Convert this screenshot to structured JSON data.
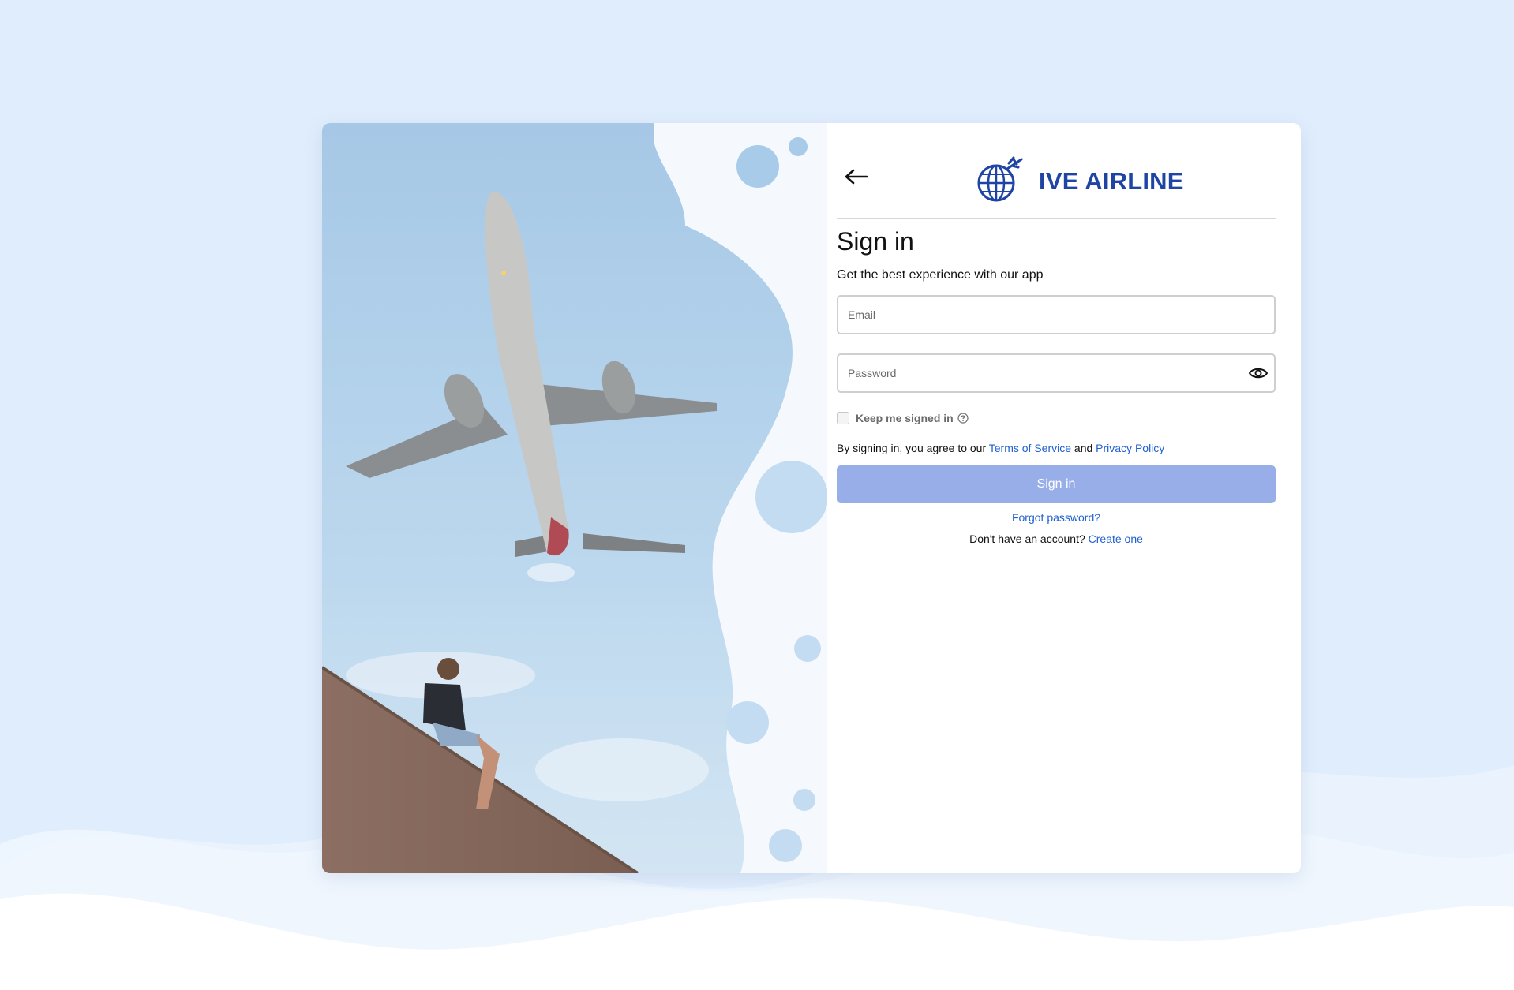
{
  "colors": {
    "page_background": "#e0edfd",
    "brand": "#1e44a4",
    "link": "#1f5fd1",
    "button_disabled": "#98aee9",
    "bubble": "#a9cbea"
  },
  "hero": {
    "image_alt": "Airplane flying overhead with a person sitting on a wall"
  },
  "header": {
    "back_icon": "arrow-left-icon",
    "logo_icon": "globe-airplane-icon",
    "brand_name": "IVE AIRLINE"
  },
  "form": {
    "title": "Sign in",
    "subtitle": "Get the best experience with our app",
    "email": {
      "placeholder": "Email",
      "value": ""
    },
    "password": {
      "placeholder": "Password",
      "value": "",
      "toggle_icon": "eye-icon"
    },
    "keep_signed_in": {
      "label": "Keep me signed in",
      "checked": false,
      "help_icon": "help-circle-icon"
    },
    "terms": {
      "prefix": "By signing in, you agree to our ",
      "terms_link": "Terms of Service",
      "conjunction": " and ",
      "privacy_link": "Privacy Policy"
    },
    "submit_label": "Sign in",
    "forgot_label": "Forgot password?",
    "signup": {
      "prompt": "Don't have an account? ",
      "link": "Create one"
    }
  }
}
